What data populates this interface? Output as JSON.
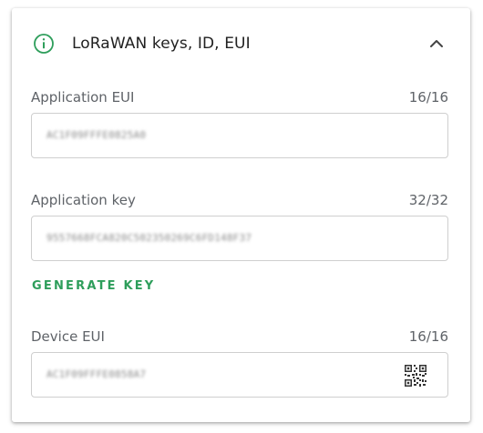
{
  "colors": {
    "accent": "#2e9e5b",
    "label": "#5f6368",
    "border": "#cfcfcf",
    "title": "#212121"
  },
  "header": {
    "title": "LoRaWAN keys, ID, EUI",
    "icon": "info-icon",
    "toggle_icon": "chevron-up-icon"
  },
  "fields": {
    "app_eui": {
      "label": "Application EUI",
      "count": "16/16",
      "value": "AC1F09FFFE0825A0"
    },
    "app_key": {
      "label": "Application key",
      "count": "32/32",
      "value": "9557668FCA820C502350269C6FD148F37"
    },
    "device_eui": {
      "label": "Device EUI",
      "count": "16/16",
      "value": "AC1F09FFFE0858A7",
      "action_icon": "qr-code-icon"
    }
  },
  "actions": {
    "generate_key_label": "GENERATE KEY"
  }
}
